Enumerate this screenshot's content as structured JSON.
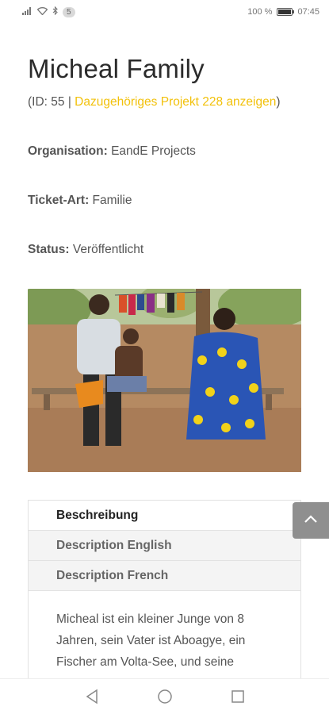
{
  "status_bar": {
    "notification_count": "5",
    "battery_percent": "100 %",
    "time": "07:45"
  },
  "page": {
    "title": "Micheal Family",
    "id_prefix": "(ID: 55 | ",
    "project_link": "Dazugehöriges Projekt 228 anzeigen",
    "id_suffix": ")",
    "organisation_label": "Organisation:",
    "organisation_value": "EandE Projects",
    "ticket_label": "Ticket-Art:",
    "ticket_value": "Familie",
    "status_label": "Status:",
    "status_value": "Veröffentlicht"
  },
  "tabs": [
    {
      "label": "Beschreibung",
      "active": true
    },
    {
      "label": "Description English",
      "active": false
    },
    {
      "label": "Description French",
      "active": false
    }
  ],
  "description": "Micheal ist ein kleiner Junge von 8 Jahren, sein Vater ist Aboagye, ein Fischer am Volta-See, und seine",
  "colors": {
    "link": "#f2c10b",
    "scroll_button": "#8f8f8f"
  },
  "icons": [
    "signal-icon",
    "wifi-icon",
    "bluetooth-icon",
    "battery-icon",
    "chevron-up-icon",
    "nav-back-icon",
    "nav-home-icon",
    "nav-recents-icon"
  ]
}
